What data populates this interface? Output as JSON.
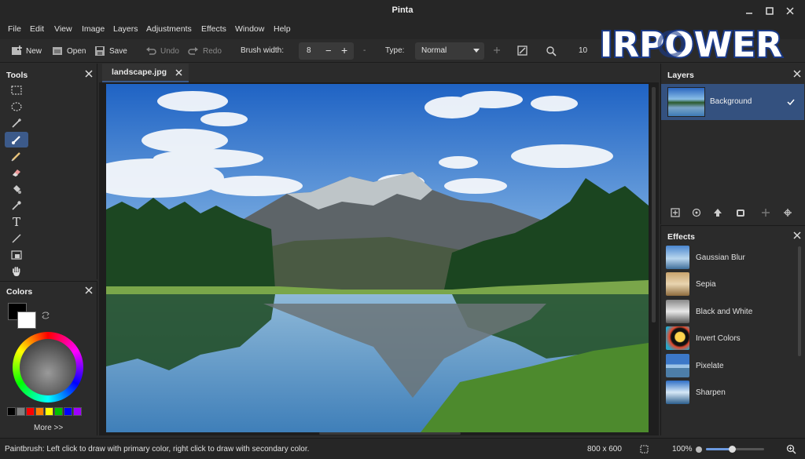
{
  "window": {
    "title": "Pinta"
  },
  "menu": [
    "File",
    "Edit",
    "View",
    "Image",
    "Layers",
    "Adjustments",
    "Effects",
    "Window",
    "Help"
  ],
  "toolbar": {
    "new_label": "New",
    "open_label": "Open",
    "save_label": "Save",
    "undo_label": "Undo",
    "redo_label": "Redo",
    "brush_width_label": "Brush width:",
    "brush_width_value": "8",
    "minus_label": "−",
    "plus_label": "+",
    "dash_label": "-",
    "type_label": "Type:",
    "type_value": "Normal",
    "zoom_value_partial": "10"
  },
  "tools_panel": {
    "title": "Tools",
    "text_tool_glyph": "T"
  },
  "colors_panel": {
    "title": "Colors",
    "primary_color": "#000000",
    "secondary_color": "#ffffff",
    "palette": [
      "#000000",
      "#7f7f7f",
      "#ff0000",
      "#ff7f00",
      "#ffff00",
      "#00c000",
      "#0000ff",
      "#a000ff"
    ],
    "more_label": "More >>"
  },
  "document": {
    "tab_label": "landscape.jpg"
  },
  "layers_panel": {
    "title": "Layers",
    "layers": [
      {
        "name": "Background",
        "visible": true
      }
    ]
  },
  "effects_panel": {
    "title": "Effects",
    "items": [
      "Gaussian Blur",
      "Sepia",
      "Black and White",
      "Invert Colors",
      "Pixelate",
      "Sharpen"
    ]
  },
  "status": {
    "message": "Paintbrush: Left click to draw with primary color, right click to draw with secondary color.",
    "image_size": "800 x 600",
    "zoom": "100%",
    "zoom_fraction": 0.45
  },
  "watermark": {
    "text": "IRPOWER"
  },
  "colors": {
    "accent": "#3c5a8a",
    "selected_layer": "#34517f"
  }
}
